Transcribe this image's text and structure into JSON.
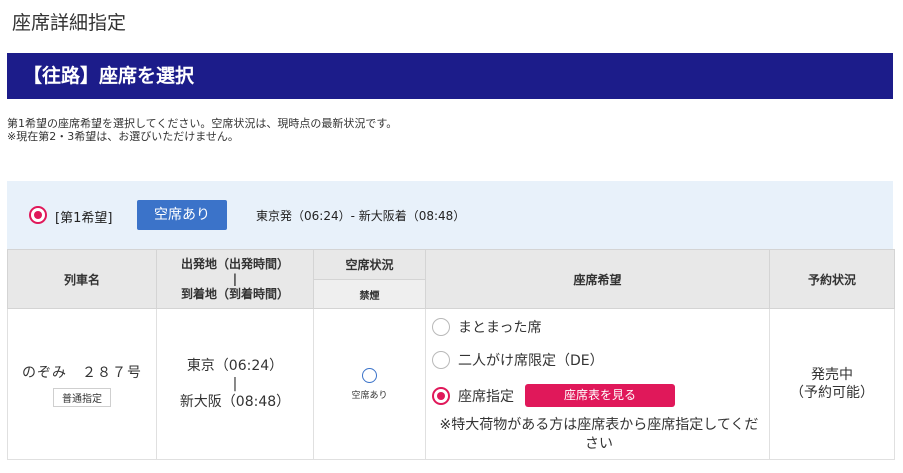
{
  "page_title": "座席詳細指定",
  "section_header": "【往路】座席を選択",
  "notes": [
    "第1希望の座席希望を選択してください。空席状況は、現時点の最新状況です。",
    "※現在第2・3希望は、お選びいただけません。"
  ],
  "choice": {
    "label": "[第1希望]",
    "badge": "空席あり",
    "route": "東京発（06:24）- 新大阪着（08:48）"
  },
  "table": {
    "headers": {
      "train_name": "列車名",
      "dep_line1": "出発地（出発時間）",
      "dep_sep": "|",
      "dep_line2": "到着地（到着時間）",
      "availability": "空席状況",
      "smoking": "禁煙",
      "seat_pref": "座席希望",
      "reservation": "予約状況"
    },
    "row": {
      "train_name": "のぞみ　２８７号",
      "seat_type": "普通指定",
      "departure": "東京（06:24）",
      "separator": "|",
      "arrival": "新大阪（08:48）",
      "availability_text": "空席あり",
      "options": [
        {
          "label": "まとまった席",
          "selected": false
        },
        {
          "label": "二人がけ席限定（DE）",
          "selected": false
        },
        {
          "label": "座席指定",
          "selected": true
        }
      ],
      "seatmap_button": "座席表を見る",
      "note": "※特大荷物がある方は座席表から座席指定してください",
      "reservation_line1": "発売中",
      "reservation_line2": "（予約可能）"
    }
  },
  "colors": {
    "header_bg": "#1c1c8a",
    "accent_pink": "#e0185a",
    "badge_blue": "#3b73c9",
    "choice_bg": "#e8f1fa"
  }
}
